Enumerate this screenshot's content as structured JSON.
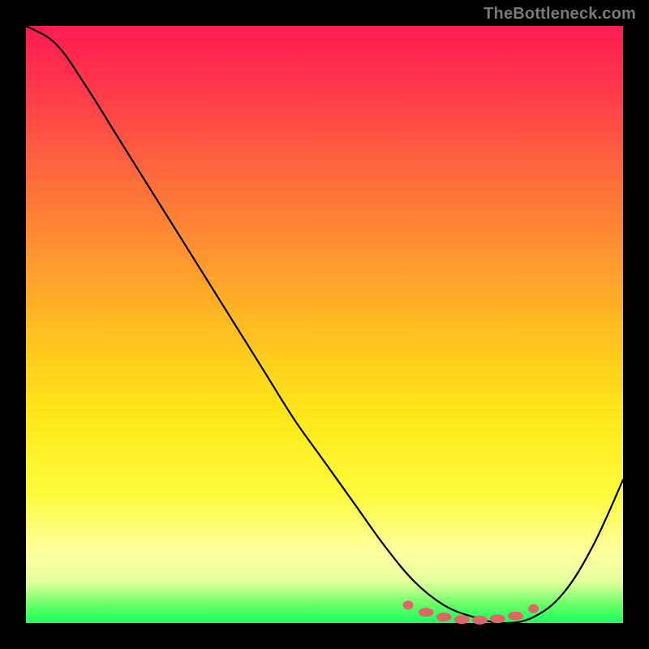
{
  "watermark": "TheBottleneck.com",
  "colors": {
    "background": "#000000",
    "curve": "#000000",
    "dots": "#e06666",
    "gradient_top": "#ff1a52",
    "gradient_bottom": "#1aff5e"
  },
  "chart_data": {
    "type": "line",
    "title": "",
    "xlabel": "",
    "ylabel": "",
    "xlim": [
      0,
      100
    ],
    "ylim": [
      0,
      100
    ],
    "grid": false,
    "legend": false,
    "x": [
      0,
      5,
      10,
      15,
      20,
      25,
      30,
      35,
      40,
      45,
      50,
      55,
      60,
      65,
      70,
      75,
      80,
      85,
      90,
      95,
      100
    ],
    "values": [
      100,
      97,
      90,
      82,
      74,
      66,
      58,
      50,
      42,
      34,
      27,
      20,
      13,
      7,
      3,
      1,
      0,
      1,
      5,
      13,
      24
    ],
    "annotations": "V-shaped bottleneck curve; minimum (optimal) region around x≈75–82 highlighted by dots",
    "highlight_points_x": [
      64,
      67,
      70,
      73,
      76,
      79,
      82,
      85
    ],
    "highlight_points_y": [
      3.0,
      1.8,
      1.0,
      0.6,
      0.5,
      0.7,
      1.2,
      2.4
    ]
  }
}
